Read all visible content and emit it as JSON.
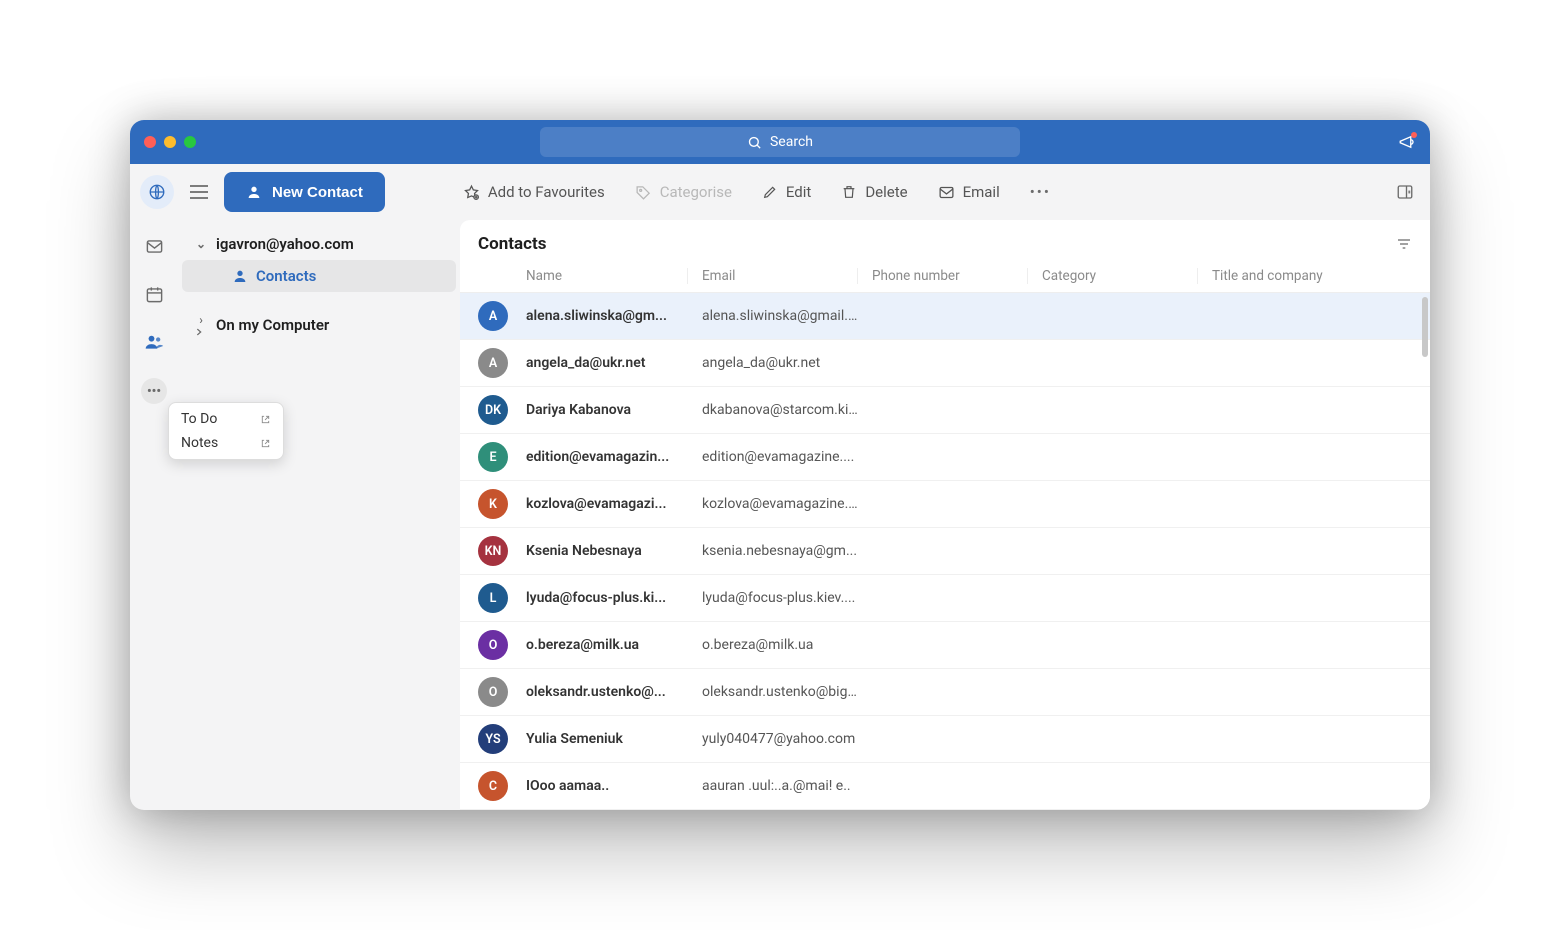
{
  "titlebar": {
    "search_placeholder": "Search"
  },
  "toolbar": {
    "new_contact": "New Contact",
    "fav": "Add to Favourites",
    "cat": "Categorise",
    "edit": "Edit",
    "delete": "Delete",
    "email": "Email"
  },
  "sidebar": {
    "account": "igavron@yahoo.com",
    "contacts": "Contacts",
    "on_my_computer": "On my Computer"
  },
  "popover": {
    "todo": "To Do",
    "notes": "Notes"
  },
  "main": {
    "title": "Contacts",
    "columns": {
      "name": "Name",
      "email": "Email",
      "phone": "Phone number",
      "category": "Category",
      "title": "Title and company"
    }
  },
  "contacts": [
    {
      "initials": "A",
      "color": "#2f6bbd",
      "name": "alena.sliwinska@gm...",
      "email": "alena.sliwinska@gmail....",
      "selected": true
    },
    {
      "initials": "A",
      "color": "#8a8a8a",
      "name": "angela_da@ukr.net",
      "email": "angela_da@ukr.net"
    },
    {
      "initials": "DK",
      "color": "#1f5b8f",
      "name": "Dariya Kabanova",
      "email": "dkabanova@starcom.ki..."
    },
    {
      "initials": "E",
      "color": "#2f8f7a",
      "name": "edition@evamagazin...",
      "email": "edition@evamagazine...."
    },
    {
      "initials": "K",
      "color": "#c6542d",
      "name": "kozlova@evamagazi...",
      "email": "kozlova@evamagazine...."
    },
    {
      "initials": "KN",
      "color": "#a5323f",
      "name": "Ksenia Nebesnaya",
      "email": "ksenia.nebesnaya@gm..."
    },
    {
      "initials": "L",
      "color": "#1f5b8f",
      "name": "lyuda@focus-plus.ki...",
      "email": "lyuda@focus-plus.kiev...."
    },
    {
      "initials": "O",
      "color": "#6b2fa3",
      "name": "o.bereza@milk.ua",
      "email": "o.bereza@milk.ua"
    },
    {
      "initials": "O",
      "color": "#8a8a8a",
      "name": "oleksandr.ustenko@...",
      "email": "oleksandr.ustenko@big..."
    },
    {
      "initials": "YS",
      "color": "#233e7a",
      "name": "Yulia Semeniuk",
      "email": "yuly040477@yahoo.com"
    },
    {
      "initials": "C",
      "color": "#c6542d",
      "name": "IOoo aamaa..",
      "email": "aauran   .uul:..a.@mai!   e.."
    }
  ]
}
